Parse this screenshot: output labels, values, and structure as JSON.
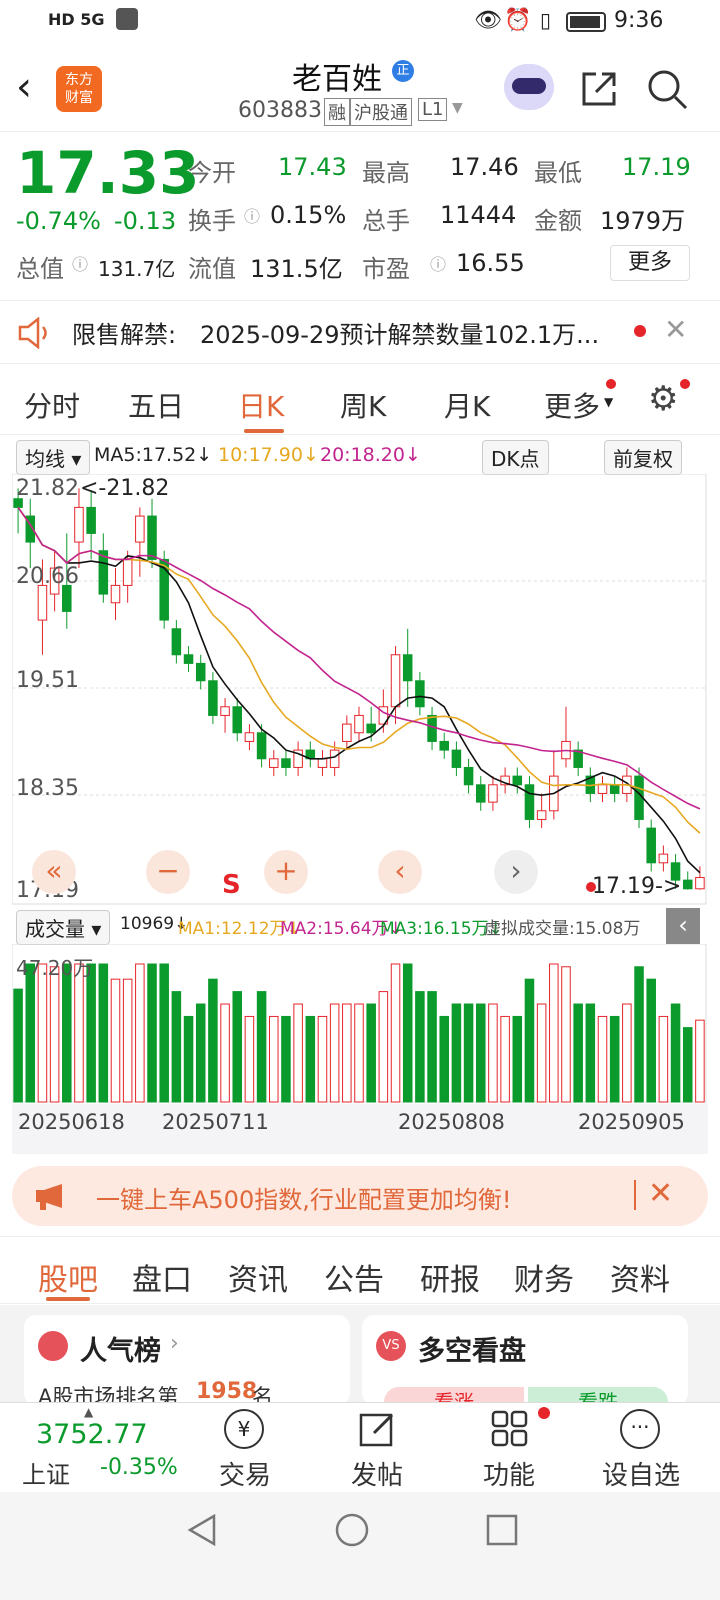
{
  "status": {
    "time": "9:36",
    "left": "HD 5G"
  },
  "header": {
    "title": "老百姓",
    "code": "603883",
    "tags": [
      "融",
      "沪股通",
      "L1"
    ],
    "logo": "东方\n财富"
  },
  "quote": {
    "price": "17.33",
    "pct": "-0.74%",
    "chg": "-0.13",
    "open_label": "今开",
    "open": "17.43",
    "high_label": "最高",
    "high": "17.46",
    "low_label": "最低",
    "low": "17.19",
    "turnover_label": "换手",
    "turnover": "0.15%",
    "vol_label": "总手",
    "vol": "11444",
    "amt_label": "金额",
    "amt": "1979万",
    "mcap_label": "总值",
    "mcap": "131.7亿",
    "float_label": "流值",
    "float": "131.5亿",
    "pe_label": "市盈",
    "pe": "16.55",
    "more": "更多"
  },
  "notice": {
    "label": "限售解禁:",
    "text": "2025-09-29预计解禁数量102.1万..."
  },
  "ktabs": [
    "分时",
    "五日",
    "日K",
    "周K",
    "月K",
    "更多"
  ],
  "chart": {
    "indicator": "均线",
    "ma5": "MA5:17.52↓",
    "ma10": "10:17.90↓",
    "ma20": "20:18.20↓",
    "dk": "DK点",
    "adjust": "前复权",
    "max_label": "<-21.82",
    "y_labels": [
      "21.82",
      "20.66",
      "19.51",
      "18.35",
      "17.19"
    ],
    "last_label": "17.19->",
    "s_label": "S"
  },
  "vol": {
    "label": "成交量",
    "v": "10969↓",
    "ma1": "MA1:12.12万↓",
    "ma2": "MA2:15.64万↓",
    "ma3": "MA3:16.15万↓",
    "virtual": "虚拟成交量:15.08万",
    "top": "47.20万"
  },
  "dates": [
    "20250618",
    "20250711",
    "20250808",
    "20250905"
  ],
  "ad": {
    "text": "一键上车A500指数,行业配置更加均衡!"
  },
  "btabs": [
    "股吧",
    "盘口",
    "资讯",
    "公告",
    "研报",
    "财务",
    "资料"
  ],
  "cards": {
    "left_title": "人气榜",
    "left_sub": "A股市场排名第",
    "rank": "1958",
    "rank_unit": "名",
    "right_title": "多空看盘",
    "up": "看涨",
    "down": "看跌"
  },
  "bottom": {
    "index_val": "3752.77",
    "index_name": "上证",
    "index_pct": "-0.35%",
    "items": [
      "交易",
      "发帖",
      "功能",
      "设自选"
    ]
  },
  "chart_data": {
    "type": "candlestick",
    "ylim": [
      17.19,
      21.82
    ],
    "candles": [
      [
        21.7,
        21.6,
        21.82,
        21.3
      ],
      [
        21.5,
        21.2,
        21.7,
        20.9
      ],
      [
        20.3,
        20.7,
        21.0,
        19.9
      ],
      [
        20.6,
        20.9,
        21.1,
        20.4
      ],
      [
        20.7,
        20.4,
        21.3,
        20.2
      ],
      [
        21.2,
        21.6,
        21.82,
        20.9
      ],
      [
        21.6,
        21.3,
        21.8,
        21.0
      ],
      [
        21.1,
        20.6,
        21.3,
        20.5
      ],
      [
        20.5,
        20.7,
        20.9,
        20.3
      ],
      [
        20.7,
        21.0,
        21.1,
        20.5
      ],
      [
        21.2,
        21.5,
        21.6,
        20.8
      ],
      [
        21.5,
        21.0,
        21.7,
        20.9
      ],
      [
        21.0,
        20.3,
        21.1,
        20.2
      ],
      [
        20.2,
        19.9,
        20.3,
        19.8
      ],
      [
        19.9,
        19.8,
        20.0,
        19.7
      ],
      [
        19.8,
        19.6,
        19.9,
        19.5
      ],
      [
        19.6,
        19.2,
        19.7,
        19.1
      ],
      [
        19.2,
        19.3,
        19.4,
        19.0
      ],
      [
        19.3,
        19.0,
        19.4,
        18.9
      ],
      [
        18.9,
        19.0,
        19.1,
        18.8
      ],
      [
        19.0,
        18.7,
        19.1,
        18.6
      ],
      [
        18.6,
        18.7,
        18.8,
        18.5
      ],
      [
        18.7,
        18.6,
        18.8,
        18.5
      ],
      [
        18.6,
        18.8,
        18.9,
        18.5
      ],
      [
        18.8,
        18.7,
        18.9,
        18.6
      ],
      [
        18.6,
        18.7,
        18.8,
        18.5
      ],
      [
        18.6,
        18.8,
        18.9,
        18.5
      ],
      [
        18.9,
        19.1,
        19.2,
        18.8
      ],
      [
        19.0,
        19.2,
        19.3,
        18.9
      ],
      [
        19.1,
        19.0,
        19.3,
        18.9
      ],
      [
        19.1,
        19.3,
        19.5,
        19.0
      ],
      [
        19.3,
        19.9,
        20.0,
        19.1
      ],
      [
        19.9,
        19.6,
        20.2,
        19.3
      ],
      [
        19.6,
        19.3,
        19.7,
        19.2
      ],
      [
        19.2,
        18.9,
        19.3,
        18.8
      ],
      [
        18.9,
        18.8,
        19.0,
        18.7
      ],
      [
        18.8,
        18.6,
        18.9,
        18.5
      ],
      [
        18.6,
        18.4,
        18.7,
        18.3
      ],
      [
        18.4,
        18.2,
        18.5,
        18.1
      ],
      [
        18.2,
        18.4,
        18.5,
        18.1
      ],
      [
        18.4,
        18.5,
        18.6,
        18.3
      ],
      [
        18.5,
        18.4,
        18.6,
        18.3
      ],
      [
        18.4,
        18.0,
        18.5,
        17.9
      ],
      [
        18.0,
        18.1,
        18.3,
        17.9
      ],
      [
        18.1,
        18.5,
        18.8,
        18.0
      ],
      [
        18.7,
        18.9,
        19.3,
        18.6
      ],
      [
        18.8,
        18.6,
        18.9,
        18.5
      ],
      [
        18.5,
        18.3,
        18.6,
        18.2
      ],
      [
        18.3,
        18.4,
        18.5,
        18.2
      ],
      [
        18.4,
        18.3,
        18.5,
        18.2
      ],
      [
        18.3,
        18.5,
        18.6,
        18.2
      ],
      [
        18.5,
        18.0,
        18.6,
        17.9
      ],
      [
        17.9,
        17.5,
        18.0,
        17.4
      ],
      [
        17.5,
        17.6,
        17.7,
        17.4
      ],
      [
        17.5,
        17.3,
        17.6,
        17.2
      ],
      [
        17.3,
        17.2,
        17.4,
        17.19
      ],
      [
        17.2,
        17.33,
        17.46,
        17.19
      ]
    ]
  }
}
